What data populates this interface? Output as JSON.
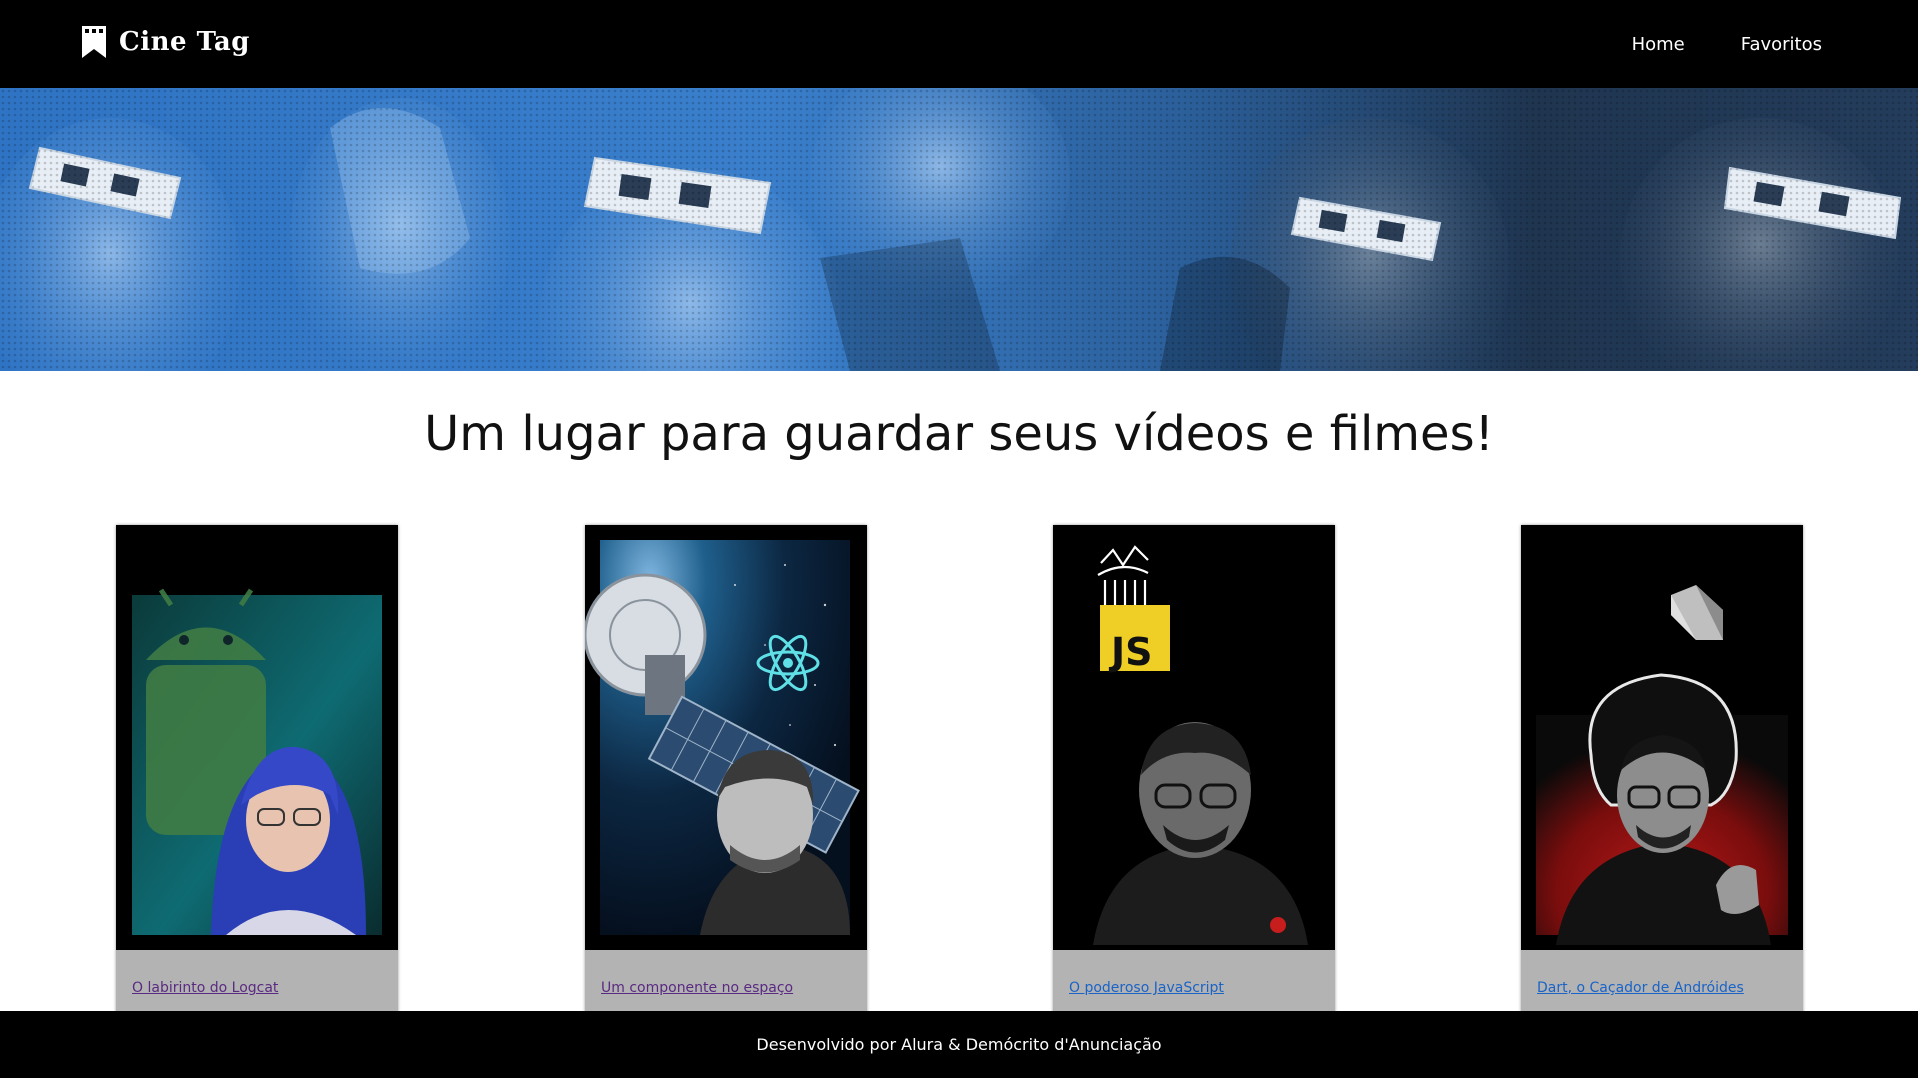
{
  "header": {
    "logo_text": "Cine Tag",
    "logo_icon": "bookmark-icon",
    "nav": [
      {
        "label": "Home"
      },
      {
        "label": "Favoritos"
      }
    ]
  },
  "hero": {
    "image": "audience-3d-glasses-photo"
  },
  "main": {
    "title": "Um lugar para guardar seus vídeos e filmes!",
    "cards": [
      {
        "title": "O labirinto do Logcat",
        "thumbnail": "android-mascot-presenter"
      },
      {
        "title": "Um componente no espaço",
        "thumbnail": "satellite-react-presenter"
      },
      {
        "title": "O poderoso JavaScript",
        "thumbnail": "javascript-logo-presenter"
      },
      {
        "title": "Dart, o Caçador de Andróides",
        "thumbnail": "dart-logo-presenter"
      }
    ]
  },
  "footer": {
    "text": "Desenvolvido por Alura & Demócrito d'Anunciação"
  },
  "colors": {
    "header_bg": "#000000",
    "hero_blue": "#3a7fcc",
    "card_bg": "#b3b3b3",
    "link_visited": "#5a2a82",
    "link_unvisited": "#1a63c7"
  }
}
